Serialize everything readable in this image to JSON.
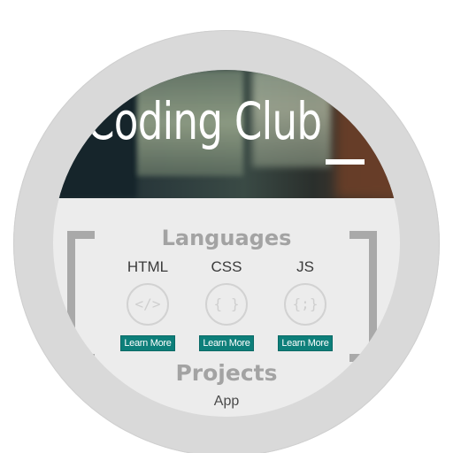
{
  "hero": {
    "title": "Coding Club"
  },
  "languages": {
    "title": "Languages",
    "items": [
      {
        "name": "HTML",
        "icon": "</>",
        "icon_name": "code-tag-icon",
        "button": "Learn More"
      },
      {
        "name": "CSS",
        "icon": "{ }",
        "icon_name": "curly-braces-icon",
        "button": "Learn More"
      },
      {
        "name": "JS",
        "icon": "{;}",
        "icon_name": "js-braces-icon",
        "button": "Learn More"
      }
    ]
  },
  "projects": {
    "title": "Projects",
    "first_item": "App"
  },
  "colors": {
    "accent": "#0d7f7a",
    "ring": "#d9d9d9",
    "section_title": "#a3a3a3"
  }
}
